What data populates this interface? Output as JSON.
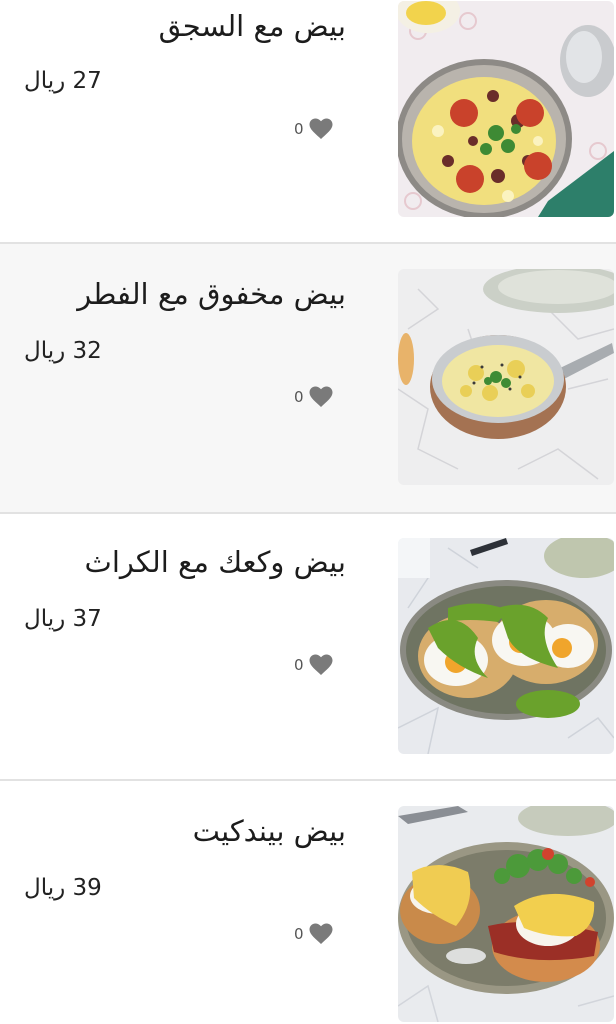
{
  "menu_items": [
    {
      "name": "بيض مع السجق",
      "price": "27 ريال",
      "likes": "0",
      "image": "scrambled-eggs-sausage-pan"
    },
    {
      "name": "بيض مخفوق مع الفطر",
      "price": "32 ريال",
      "likes": "0",
      "image": "scrambled-eggs-mushroom-pan"
    },
    {
      "name": "بيض وكعك مع الكراث",
      "price": "37 ريال",
      "likes": "0",
      "image": "eggs-buns-leek-sauce-plate"
    },
    {
      "name": "بيض بيندكيت",
      "price": "39 ريال",
      "likes": "0",
      "image": "eggs-benedict-plate"
    }
  ],
  "icons": {
    "like": "heart-icon"
  },
  "colors": {
    "heart": "#7a7a7a",
    "card_alt_background": "#f7f7f7",
    "divider": "#e2e2e2"
  }
}
